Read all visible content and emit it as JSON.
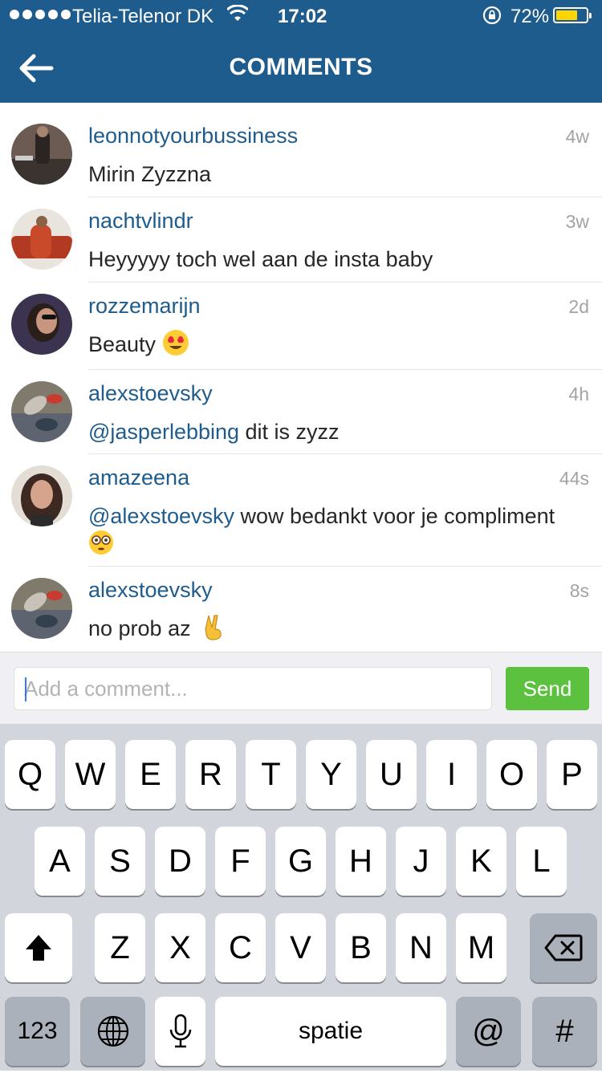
{
  "status_bar": {
    "carrier": "Telia-Telenor DK",
    "time": "17:02",
    "battery_percent_label": "72%",
    "battery_level": 0.72,
    "icons": [
      "signal-dots-icon",
      "wifi-icon",
      "rotation-lock-icon",
      "battery-icon"
    ]
  },
  "header": {
    "title": "COMMENTS",
    "back_icon": "back-arrow-icon"
  },
  "comments": [
    {
      "user": "leonnotyourbussiness",
      "age": "4w",
      "mention": "",
      "text": "Mirin Zyzzna",
      "emoji": ""
    },
    {
      "user": "nachtvlindr",
      "age": "3w",
      "mention": "",
      "text": "Heyyyyy toch wel aan de insta baby",
      "emoji": ""
    },
    {
      "user": "rozzemarijn",
      "age": "2d",
      "mention": "",
      "text": "Beauty",
      "emoji": "heart-eyes-emoji"
    },
    {
      "user": "alexstoevsky",
      "age": "4h",
      "mention": "@jasperlebbing",
      "text": " dit is zyzz",
      "emoji": ""
    },
    {
      "user": "amazeena",
      "age": "44s",
      "mention": "@alexstoevsky",
      "text": " wow bedankt voor je compliment",
      "emoji": "flushed-emoji"
    },
    {
      "user": "alexstoevsky",
      "age": "8s",
      "mention": "",
      "text": "no prob az",
      "emoji": "victory-hand-emoji"
    }
  ],
  "composer": {
    "placeholder": "Add a comment...",
    "send_label": "Send",
    "send_color": "#5cc13f"
  },
  "keyboard": {
    "row1": [
      "Q",
      "W",
      "E",
      "R",
      "T",
      "Y",
      "U",
      "I",
      "O",
      "P"
    ],
    "row2": [
      "A",
      "S",
      "D",
      "F",
      "G",
      "H",
      "J",
      "K",
      "L"
    ],
    "row3": [
      "Z",
      "X",
      "C",
      "V",
      "B",
      "N",
      "M"
    ],
    "numbers_label": "123",
    "space_label": "spatie",
    "at_label": "@",
    "hash_label": "#",
    "icons": [
      "shift-icon",
      "backspace-icon",
      "globe-icon",
      "microphone-icon"
    ]
  },
  "colors": {
    "header_blue": "#1f5c8e",
    "link_blue": "#1f5c8e",
    "timestamp_gray": "#a3a3a3"
  }
}
